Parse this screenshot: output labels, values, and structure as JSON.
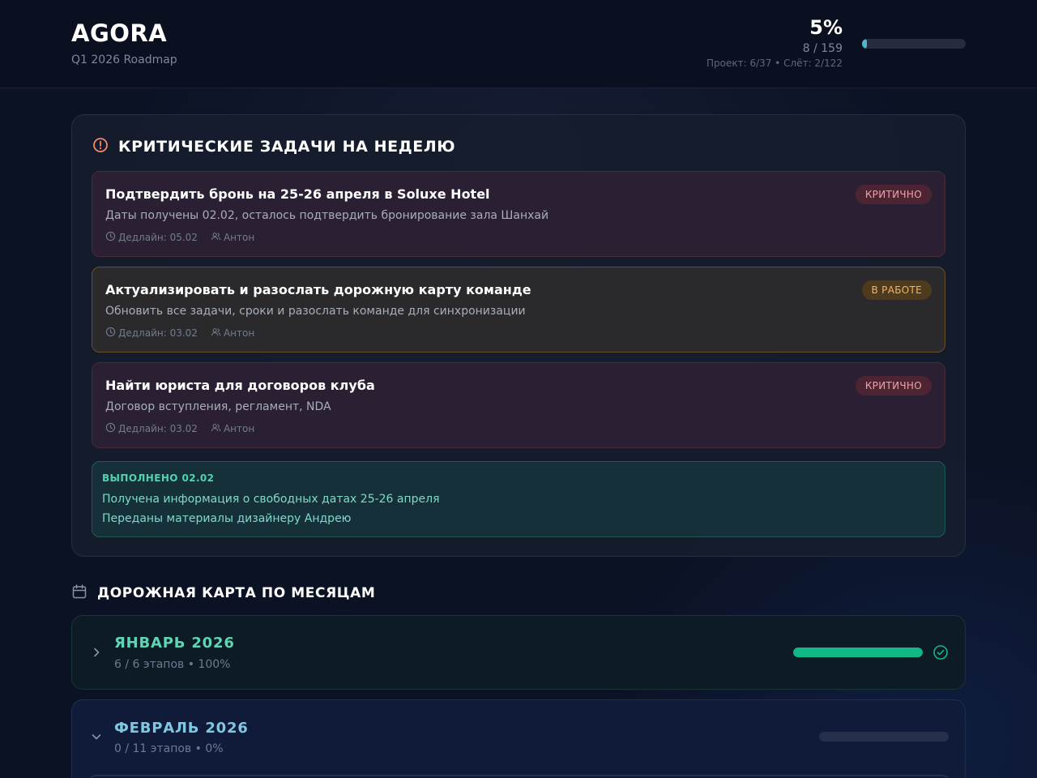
{
  "header": {
    "title": "AGORA",
    "subtitle": "Q1 2026 Roadmap",
    "progress_pct_label": "5%",
    "progress_fraction": 0.05,
    "progress_count": "8 / 159",
    "progress_detail": "Проект: 6/37 • Слёт: 2/122"
  },
  "critical": {
    "title": "КРИТИЧЕСКИЕ ЗАДАЧИ НА НЕДЕЛЮ",
    "icon": "alert-circle-icon",
    "tasks": [
      {
        "title": "Подтвердить бронь на 25-26 апреля в Soluxe Hotel",
        "description": "Даты получены 02.02, осталось подтвердить бронирование зала Шанхай",
        "deadline": "Дедлайн: 05.02",
        "owner": "Антон",
        "badge": "КРИТИЧНО",
        "status": "critical"
      },
      {
        "title": "Актуализировать и разослать дорожную карту команде",
        "description": "Обновить все задачи, сроки и разослать команде для синхронизации",
        "deadline": "Дедлайн: 03.02",
        "owner": "Антон",
        "badge": "В РАБОТЕ",
        "status": "in-progress"
      },
      {
        "title": "Найти юриста для договоров клуба",
        "description": "Договор вступления, регламент, NDA",
        "deadline": "Дедлайн: 03.02",
        "owner": "Антон",
        "badge": "КРИТИЧНО",
        "status": "critical"
      }
    ],
    "done": {
      "title": "ВЫПОЛНЕНО 02.02",
      "items": [
        "Получена информация о свободных датах 25-26 апреля",
        "Переданы материалы дизайнеру Андрею"
      ]
    }
  },
  "roadmap": {
    "title": "ДОРОЖНАЯ КАРТА ПО МЕСЯЦАМ",
    "icon": "calendar-icon",
    "months": [
      {
        "name": "ЯНВАРЬ 2026",
        "summary": "6 / 6 этапов • 100%",
        "progress_fraction": 1.0,
        "expanded": false,
        "complete": true
      },
      {
        "name": "ФЕВРАЛЬ 2026",
        "summary": "0 / 11 этапов • 0%",
        "progress_fraction": 0.0,
        "expanded": true,
        "complete": false
      }
    ]
  },
  "colors": {
    "critical": "#f0a2a8",
    "in_progress": "#f2b46c",
    "done": "#4fd3b0",
    "progress_accent": "#4fb8c9",
    "month_complete": "#12b886"
  }
}
